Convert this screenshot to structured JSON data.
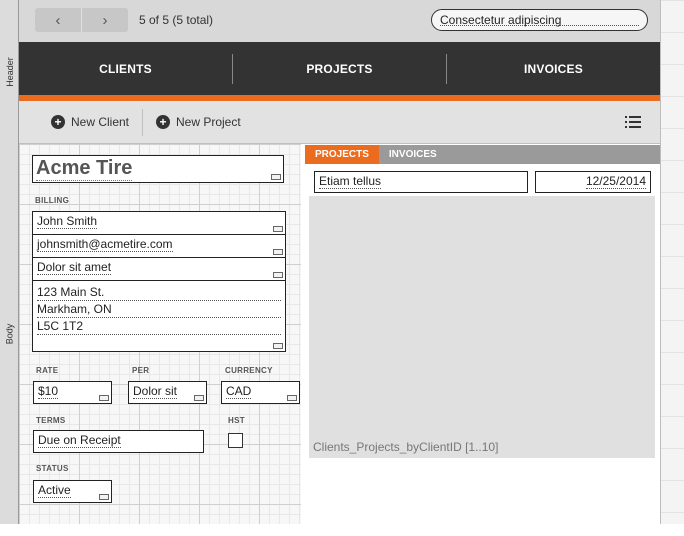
{
  "part_labels": {
    "header": "Header",
    "body": "Body"
  },
  "toolbar": {
    "prev_symbol": "‹",
    "next_symbol": "›",
    "record_count": "5 of 5  (5 total)",
    "search_value": "Consectetur adipiscing"
  },
  "nav": {
    "tabs": [
      "CLIENTS",
      "PROJECTS",
      "INVOICES"
    ]
  },
  "actions": {
    "new_client": "New Client",
    "new_project": "New Project"
  },
  "client": {
    "name": "Acme Tire",
    "billing_label": "BILLING",
    "contact": "John Smith",
    "email": "johnsmith@acmetire.com",
    "extra": "Dolor sit amet",
    "address": [
      "123 Main St.",
      "Markham, ON",
      "L5C 1T2"
    ],
    "rate_label": "RATE",
    "rate": "$10",
    "per_label": "PER",
    "per": "Dolor sit",
    "currency_label": "CURRENCY",
    "currency": "CAD",
    "terms_label": "TERMS",
    "terms": "Due on Receipt",
    "hst_label": "HST",
    "status_label": "STATUS",
    "status": "Active"
  },
  "portal": {
    "tabs": [
      "PROJECTS",
      "INVOICES"
    ],
    "active_tab": "PROJECTS",
    "row": {
      "name": "Etiam tellus",
      "date": "12/25/2014"
    },
    "caption": "Clients_Projects_byClientID [1..10]"
  },
  "colors": {
    "accent": "#ec6c1f",
    "nav_bg": "#333333",
    "toolbar_bg": "#d8d8d8"
  }
}
